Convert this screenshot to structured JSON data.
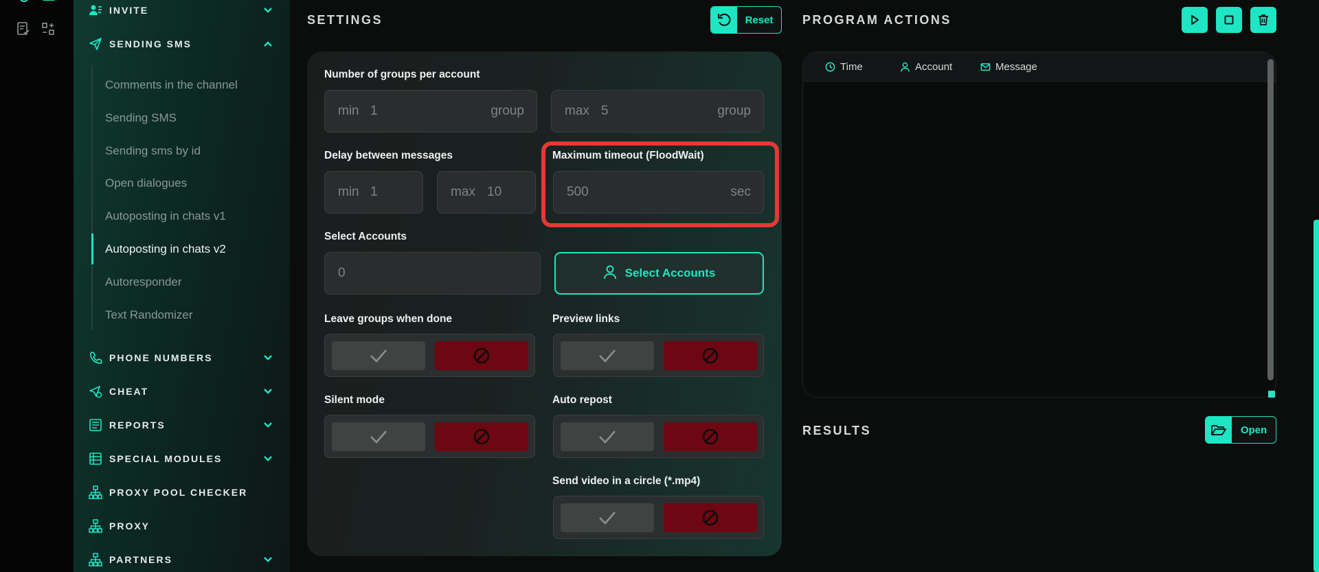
{
  "sidebar": {
    "invite": "INVITE",
    "sending_sms": "SENDING SMS",
    "sub_items": [
      "Comments in the channel",
      "Sending SMS",
      "Sending sms by id",
      "Open dialogues",
      "Autoposting in chats v1",
      "Autoposting in chats v2",
      "Autoresponder",
      "Text Randomizer"
    ],
    "active_sub_item": "Autoposting in chats v2",
    "phone_numbers": "PHONE NUMBERS",
    "cheat": "CHEAT",
    "reports": "REPORTS",
    "special_modules": "SPECIAL MODULES",
    "proxy_pool_checker": "PROXY POOL CHECKER",
    "proxy": "PROXY",
    "partners": "PARTNERS"
  },
  "settings": {
    "title": "SETTINGS",
    "reset_label": "Reset",
    "groups_per_account": {
      "label": "Number of groups per account",
      "min_prefix": "min",
      "min_value": "1",
      "max_prefix": "max",
      "max_value": "5",
      "unit": "group"
    },
    "delay": {
      "label": "Delay between messages",
      "min_prefix": "min",
      "min_value": "1",
      "max_prefix": "max",
      "max_value": "10"
    },
    "max_timeout": {
      "label": "Maximum timeout (FloodWait)",
      "value": "500",
      "unit": "sec"
    },
    "select_accounts": {
      "label": "Select Accounts",
      "value": "0",
      "button_label": "Select Accounts"
    },
    "toggles": {
      "leave_groups": "Leave groups when done",
      "preview_links": "Preview links",
      "silent_mode": "Silent mode",
      "auto_repost": "Auto repost",
      "send_video": "Send video in a circle (*.mp4)"
    }
  },
  "program_actions": {
    "title": "PROGRAM ACTIONS",
    "columns": [
      "Time",
      "Account",
      "Message"
    ]
  },
  "results": {
    "title": "RESULTS",
    "open_label": "Open"
  },
  "colors": {
    "accent": "#1ee6c4",
    "deny": "#6e0712",
    "highlight": "#e23a35"
  }
}
